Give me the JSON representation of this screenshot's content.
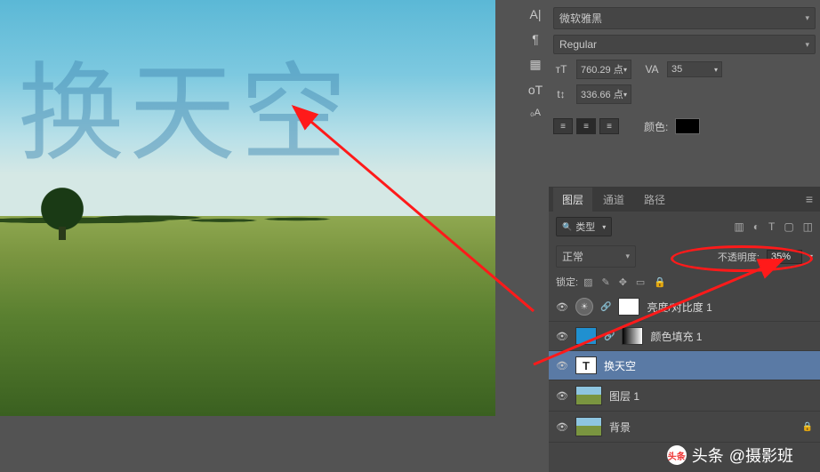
{
  "character_panel": {
    "font_family": "微软雅黑",
    "font_style": "Regular",
    "font_size": "760.29 点",
    "tracking": "35",
    "leading": "336.66 点",
    "color_label": "颜色:",
    "color_value": "#000000"
  },
  "layers_panel": {
    "tabs": [
      "图层",
      "通道",
      "路径"
    ],
    "active_tab": 0,
    "type_filter": "类型",
    "blend_mode": "正常",
    "opacity_label": "不透明度:",
    "opacity_value": "35%",
    "lock_label": "锁定:",
    "layers": [
      {
        "name": "亮度/对比度 1",
        "kind": "adjustment",
        "visible": true
      },
      {
        "name": "颜色填充 1",
        "kind": "fill",
        "visible": true
      },
      {
        "name": "换天空",
        "kind": "text",
        "visible": true,
        "selected": true
      },
      {
        "name": "图层 1",
        "kind": "image",
        "visible": true
      },
      {
        "name": "背景",
        "kind": "image",
        "visible": true,
        "locked": true
      }
    ]
  },
  "canvas_text": "换天空",
  "watermark": {
    "prefix": "头条",
    "user": "@摄影班"
  }
}
